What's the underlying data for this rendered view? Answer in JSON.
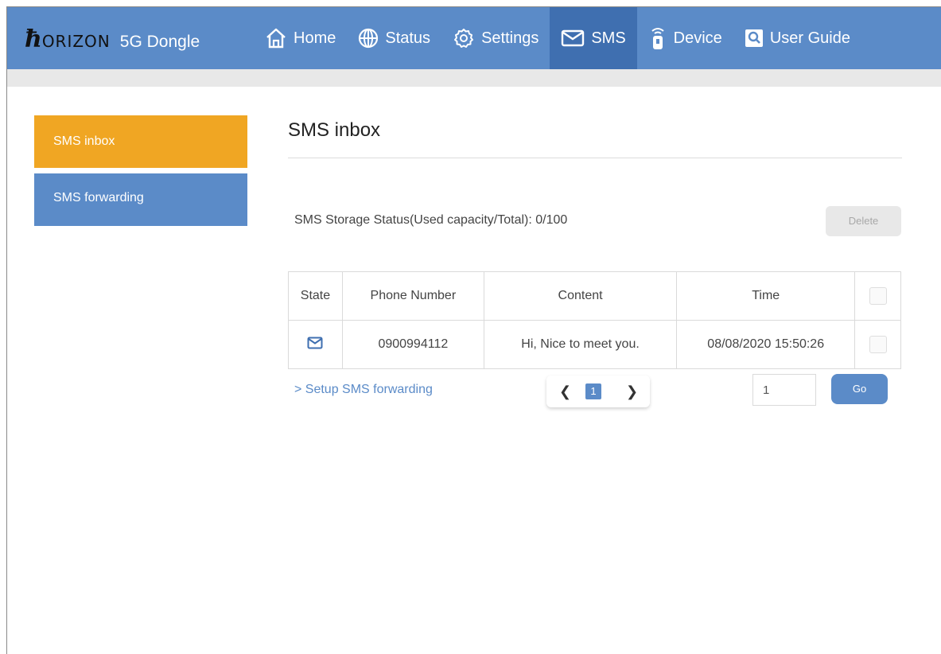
{
  "brand": {
    "mark": "ℌ",
    "name": "ORIZON",
    "product": "5G Dongle"
  },
  "nav": {
    "home": "Home",
    "status": "Status",
    "settings": "Settings",
    "sms": "SMS",
    "device": "Device",
    "user_guide": "User Guide"
  },
  "sidebar": {
    "items": [
      {
        "label": "SMS inbox",
        "active": true
      },
      {
        "label": "SMS forwarding",
        "active": false
      }
    ]
  },
  "main": {
    "title": "SMS inbox",
    "storage_status": "SMS Storage Status(Used capacity/Total): 0/100",
    "delete_label": "Delete",
    "table": {
      "headers": [
        "State",
        "Phone Number",
        "Content",
        "Time"
      ],
      "rows": [
        {
          "state_icon": "envelope-icon",
          "phone": "0900994112",
          "content": "Hi, Nice to meet you.",
          "time": "08/08/2020 15:50:26"
        }
      ]
    },
    "setup_link": "> Setup SMS forwarding",
    "pagination": {
      "current": "1"
    },
    "page_input_value": "1",
    "go_label": "Go"
  },
  "colors": {
    "primary": "#5b8bc8",
    "active_nav": "#3f6fb0",
    "accent": "#f0a623"
  }
}
